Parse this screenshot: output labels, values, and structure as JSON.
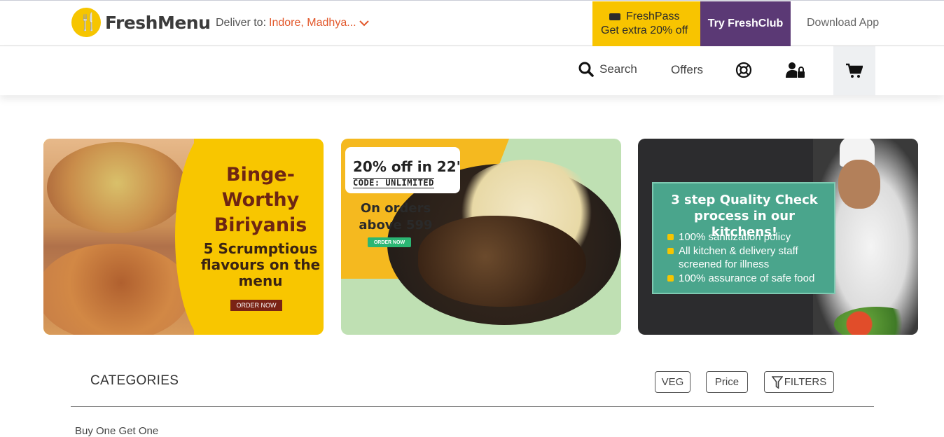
{
  "header": {
    "brand": "FreshMenu",
    "deliver_label": "Deliver to:",
    "deliver_location": "Indore, Madhya...",
    "freshpass_title": "FreshPass",
    "freshpass_offer": "Get extra 20% off",
    "freshclub_label": "Try FreshClub",
    "download_label": "Download App"
  },
  "nav": {
    "search_label": "Search",
    "offers_label": "Offers",
    "icons": [
      "search-icon",
      "help-lifebuoy-icon",
      "user-lock-icon",
      "cart-icon"
    ]
  },
  "banners": [
    {
      "title": "Binge-Worthy Biriyanis",
      "subtitle": "5 Scrumptious flavours on the menu",
      "cta": "ORDER NOW"
    },
    {
      "headline": "20% off in 22'",
      "code": "CODE: UNLIMITED",
      "condition": "On orders above 599",
      "cta": "ORDER NOW"
    },
    {
      "title": "3 step Quality Check process in our kitchens!",
      "points": [
        "100% sanitization policy",
        "All kitchen & delivery staff screened for illness",
        "100% assurance of safe food"
      ]
    }
  ],
  "catalog": {
    "categories_heading": "CATEGORIES",
    "filter_chips": [
      "VEG",
      "Price",
      "FILTERS"
    ],
    "first_section": "Buy One Get One"
  },
  "colors": {
    "brand_yellow": "#f8c600",
    "freshclub_purple": "#5b3975",
    "location_orange": "#e2572a"
  }
}
